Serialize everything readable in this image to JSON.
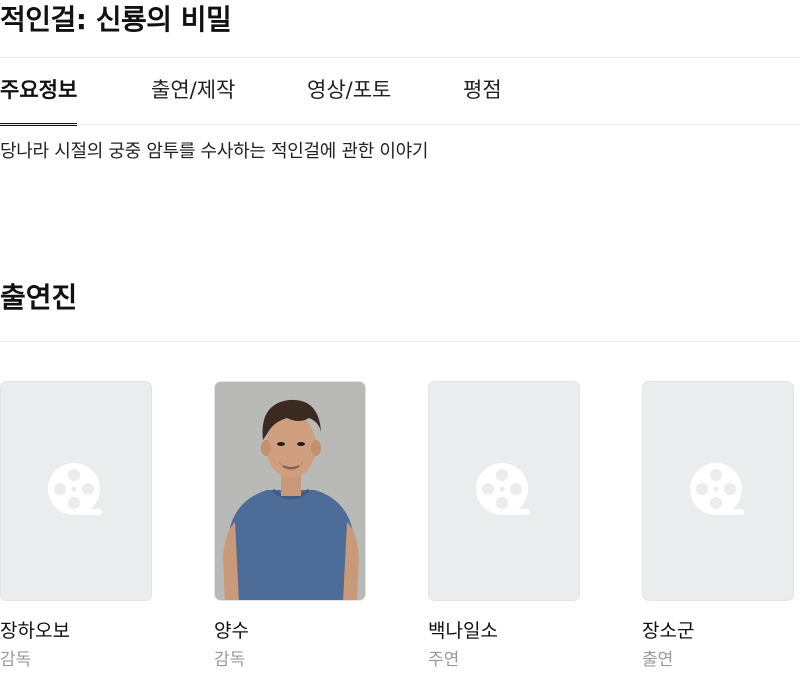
{
  "title": "적인걸: 신룡의 비밀",
  "tabs": [
    {
      "label": "주요정보",
      "active": true
    },
    {
      "label": "출연/제작",
      "active": false
    },
    {
      "label": "영상/포토",
      "active": false
    },
    {
      "label": "평점",
      "active": false
    }
  ],
  "synopsis": "당나라 시절의 궁중 암투를 수사하는 적인걸에 관한 이야기",
  "cast_section": {
    "title": "출연진",
    "members": [
      {
        "name": "장하오보",
        "role": "감독",
        "photo": "placeholder-film-reel-icon"
      },
      {
        "name": "양수",
        "role": "감독",
        "photo": "person-photo"
      },
      {
        "name": "백나일소",
        "role": "주연",
        "photo": "placeholder-film-reel-icon"
      },
      {
        "name": "장소군",
        "role": "출연",
        "photo": "placeholder-film-reel-icon"
      }
    ]
  },
  "colors": {
    "placeholder_bg": "#ebecee",
    "reel_icon": "#ffffff",
    "role_text": "#9a9a9a",
    "divider": "#ececec"
  }
}
